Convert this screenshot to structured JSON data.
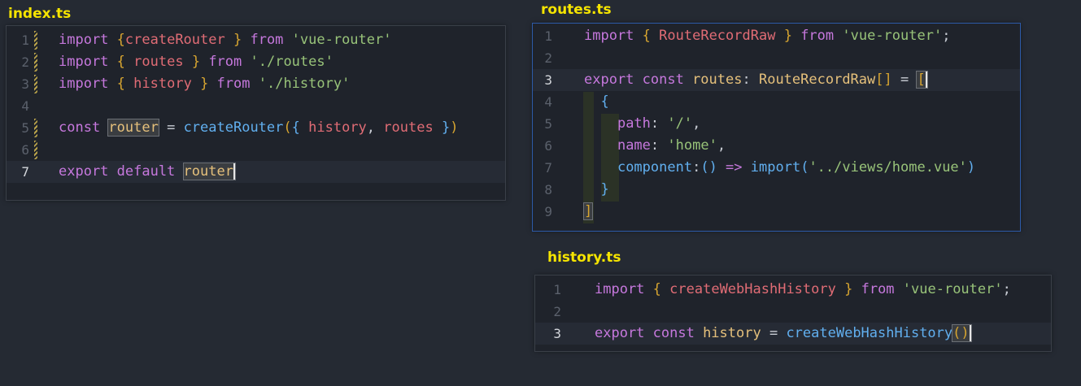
{
  "files": {
    "index": {
      "title": "index.ts",
      "lines": [
        {
          "num": "1",
          "parts": [
            [
              "kw",
              "import "
            ],
            [
              "brk",
              "{"
            ],
            [
              "var",
              "createRouter"
            ],
            [
              "pun",
              " "
            ],
            [
              "brk",
              "}"
            ],
            [
              "kw",
              " from "
            ],
            [
              "str",
              "'vue-router'"
            ]
          ]
        },
        {
          "num": "2",
          "parts": [
            [
              "kw",
              "import "
            ],
            [
              "brk",
              "{"
            ],
            [
              "pun",
              " "
            ],
            [
              "var",
              "routes"
            ],
            [
              "pun",
              " "
            ],
            [
              "brk",
              "}"
            ],
            [
              "kw",
              " from "
            ],
            [
              "str",
              "'./routes'"
            ]
          ]
        },
        {
          "num": "3",
          "parts": [
            [
              "kw",
              "import "
            ],
            [
              "brk",
              "{"
            ],
            [
              "pun",
              " "
            ],
            [
              "var",
              "history"
            ],
            [
              "pun",
              " "
            ],
            [
              "brk",
              "}"
            ],
            [
              "kw",
              " from "
            ],
            [
              "str",
              "'./history'"
            ]
          ]
        },
        {
          "num": "4",
          "parts": []
        },
        {
          "num": "5",
          "parts": [
            [
              "kw",
              "const "
            ],
            [
              "typ",
              "router"
            ],
            [
              "pun",
              " = "
            ],
            [
              "fn",
              "createRouter"
            ],
            [
              "brk",
              "("
            ],
            [
              "fn",
              "{"
            ],
            [
              "pun",
              " "
            ],
            [
              "var",
              "history"
            ],
            [
              "pun",
              ", "
            ],
            [
              "var",
              "routes"
            ],
            [
              "pun",
              " "
            ],
            [
              "fn",
              "}"
            ],
            [
              "brk",
              ")"
            ]
          ]
        },
        {
          "num": "6",
          "parts": []
        },
        {
          "num": "7",
          "parts": [
            [
              "kw",
              "export default "
            ],
            [
              "typ",
              "router"
            ]
          ]
        }
      ]
    },
    "routes": {
      "title": "routes.ts",
      "lines": [
        {
          "num": "1",
          "parts": [
            [
              "kw",
              "import "
            ],
            [
              "brk",
              "{"
            ],
            [
              "pun",
              " "
            ],
            [
              "var",
              "RouteRecordRaw"
            ],
            [
              "pun",
              " "
            ],
            [
              "brk",
              "}"
            ],
            [
              "kw",
              " from "
            ],
            [
              "str",
              "'vue-router'"
            ],
            [
              "pun",
              ";"
            ]
          ]
        },
        {
          "num": "2",
          "parts": []
        },
        {
          "num": "3",
          "parts": [
            [
              "kw",
              "export const "
            ],
            [
              "typ",
              "routes"
            ],
            [
              "pun",
              ": "
            ],
            [
              "typ",
              "RouteRecordRaw"
            ],
            [
              "brk",
              "[]"
            ],
            [
              "pun",
              " = "
            ],
            [
              "brk",
              "["
            ]
          ]
        },
        {
          "num": "4",
          "parts": [
            [
              "pun",
              "  "
            ],
            [
              "fn",
              "{"
            ]
          ]
        },
        {
          "num": "5",
          "parts": [
            [
              "pun",
              "    "
            ],
            [
              "prp",
              "path"
            ],
            [
              "pun",
              ": "
            ],
            [
              "str",
              "'/'"
            ],
            [
              "pun",
              ","
            ]
          ]
        },
        {
          "num": "6",
          "parts": [
            [
              "pun",
              "    "
            ],
            [
              "prp",
              "name"
            ],
            [
              "pun",
              ": "
            ],
            [
              "str",
              "'home'"
            ],
            [
              "pun",
              ","
            ]
          ]
        },
        {
          "num": "7",
          "parts": [
            [
              "pun",
              "    "
            ],
            [
              "cmp",
              "component"
            ],
            [
              "pun",
              ":"
            ],
            [
              "fn",
              "()"
            ],
            [
              "kw",
              " => "
            ],
            [
              "fn",
              "import"
            ],
            [
              "fn",
              "("
            ],
            [
              "str",
              "'../views/home.vue'"
            ],
            [
              "fn",
              ")"
            ]
          ]
        },
        {
          "num": "8",
          "parts": [
            [
              "pun",
              "  "
            ],
            [
              "fn",
              "}"
            ]
          ]
        },
        {
          "num": "9",
          "parts": [
            [
              "brk",
              "]"
            ]
          ]
        }
      ]
    },
    "history": {
      "title": "history.ts",
      "lines": [
        {
          "num": "1",
          "parts": [
            [
              "kw",
              "import "
            ],
            [
              "brk",
              "{"
            ],
            [
              "pun",
              " "
            ],
            [
              "var",
              "createWebHashHistory"
            ],
            [
              "pun",
              " "
            ],
            [
              "brk",
              "}"
            ],
            [
              "kw",
              " from "
            ],
            [
              "str",
              "'vue-router'"
            ],
            [
              "pun",
              ";"
            ]
          ]
        },
        {
          "num": "2",
          "parts": []
        },
        {
          "num": "3",
          "parts": [
            [
              "kw",
              "export const "
            ],
            [
              "typ",
              "history"
            ],
            [
              "pun",
              " = "
            ],
            [
              "fn",
              "createWebHashHistory"
            ],
            [
              "brk",
              "()"
            ]
          ]
        }
      ]
    }
  },
  "colors": {
    "background": "#252a33",
    "panel": "#1f232b",
    "file_title": "#f5e400",
    "active_border": "#2d5aa8"
  }
}
